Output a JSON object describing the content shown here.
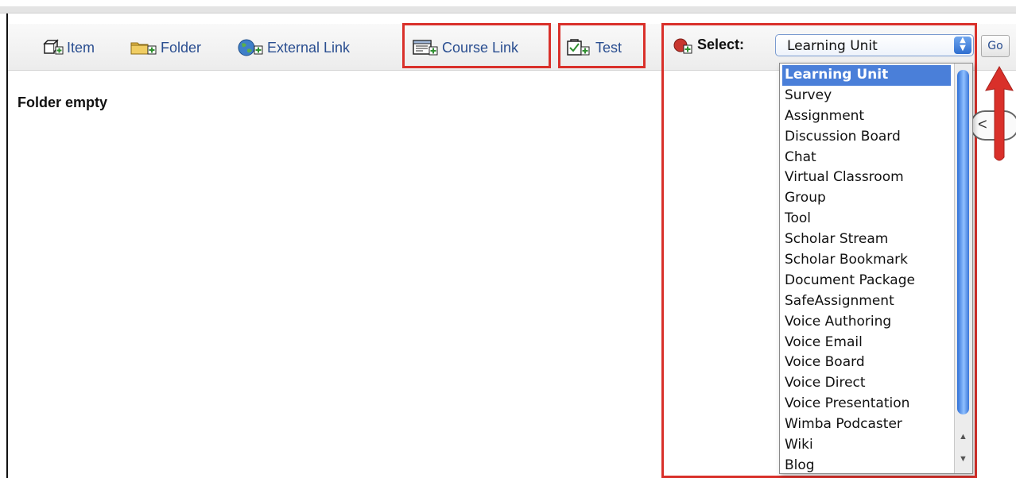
{
  "toolbar": {
    "item_label": "Item",
    "folder_label": "Folder",
    "external_link_label": "External Link",
    "course_link_label": "Course Link",
    "test_label": "Test",
    "select_label": "Select:",
    "select_value": "Learning Unit",
    "go_label": "Go"
  },
  "content": {
    "folder_empty": "Folder empty",
    "behind_button_glyph": "<"
  },
  "dropdown": {
    "options": [
      "Learning Unit",
      "Survey",
      "Assignment",
      "Discussion Board",
      "Chat",
      "Virtual Classroom",
      "Group",
      "Tool",
      "Scholar Stream",
      "Scholar Bookmark",
      "Document Package",
      "SafeAssignment",
      "Voice Authoring",
      "Voice Email",
      "Voice Board",
      "Voice Direct",
      "Voice Presentation",
      "Wimba Podcaster",
      "Wiki",
      "Blog"
    ],
    "selected_index": 0
  },
  "annotations": {
    "highlight_color": "#d9302a"
  },
  "colors": {
    "link_text": "#2a4e90",
    "selection": "#4a7fd9"
  }
}
